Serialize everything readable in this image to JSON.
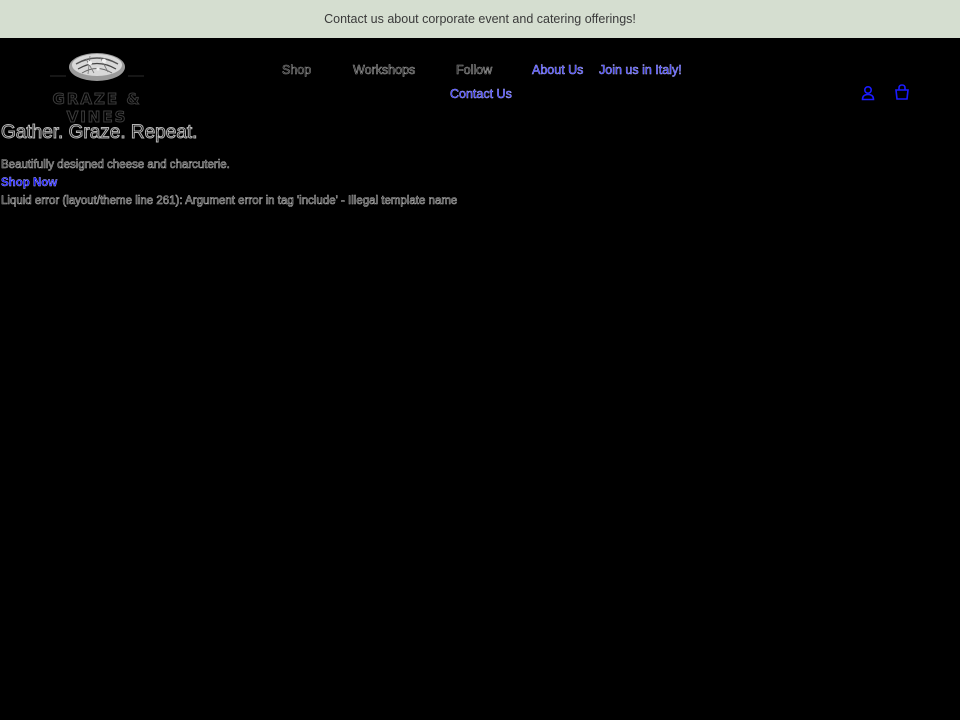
{
  "announcement": {
    "text": "Contact us about corporate event and catering offerings!"
  },
  "header": {
    "logo_text": "GRAZE & VINES",
    "nav": [
      {
        "label": "Shop"
      },
      {
        "label": "Workshops"
      },
      {
        "label": "Follow"
      },
      {
        "label": "About Us"
      },
      {
        "label": "Join us in Italy!"
      },
      {
        "label": "Contact Us"
      }
    ],
    "icons": {
      "account": "account-icon",
      "cart": "cart-icon"
    }
  },
  "hero": {
    "title": "Gather. Graze. Repeat.",
    "subtitle": "Beautifully designed cheese and charcuterie.",
    "cta_label": "Shop Now",
    "error_text": "Liquid error (layout/theme line 261): Argument error in tag 'include' - Illegal template name"
  },
  "colors": {
    "announcement_bg": "#d5ded0",
    "page_bg": "#000000",
    "link": "#1b1bff"
  }
}
